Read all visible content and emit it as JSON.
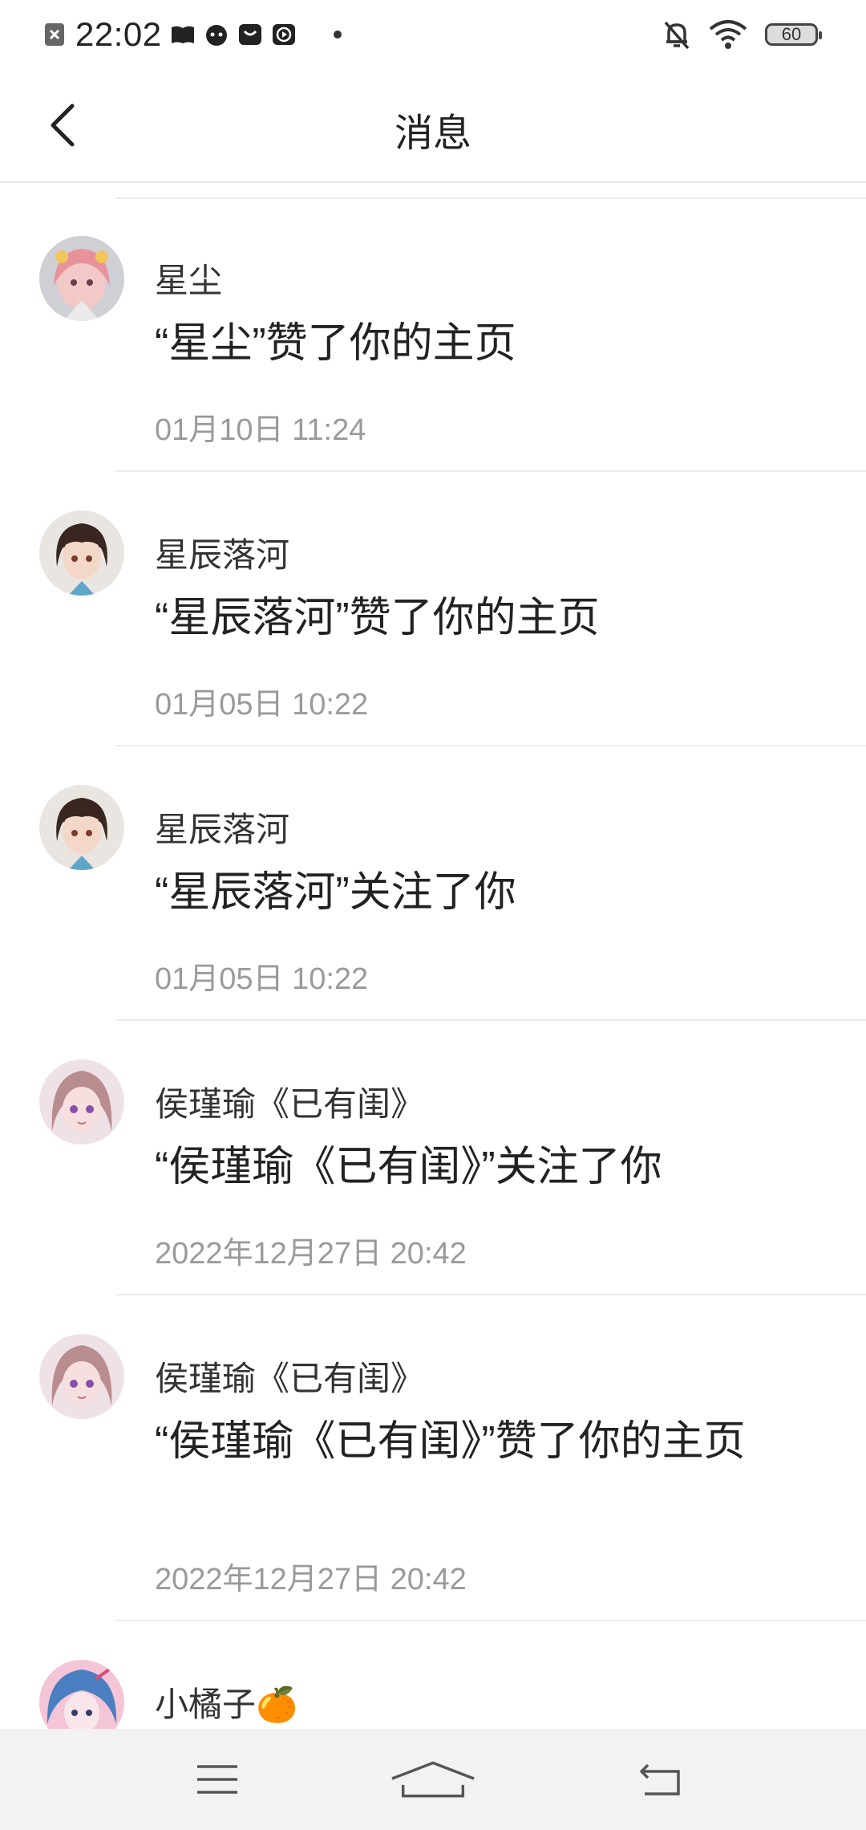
{
  "status": {
    "time": "22:02",
    "battery": "60"
  },
  "header": {
    "title": "消息"
  },
  "messages": [
    {
      "name": "星尘",
      "text": "“星尘”赞了你的主页",
      "time": "01月10日 11:24"
    },
    {
      "name": "星辰落河",
      "text": "“星辰落河”赞了你的主页",
      "time": "01月05日 10:22"
    },
    {
      "name": "星辰落河",
      "text": "“星辰落河”关注了你",
      "time": "01月05日 10:22"
    },
    {
      "name": "侯瑾瑜《已有闺》",
      "text": "“侯瑾瑜《已有闺》”关注了你",
      "time": "2022年12月27日 20:42"
    },
    {
      "name": "侯瑾瑜《已有闺》",
      "text": "“侯瑾瑜《已有闺》”赞了你的主页",
      "time": "2022年12月27日 20:42"
    },
    {
      "name": "小橘子🍊"
    }
  ],
  "icons": {
    "back": "chevron-left-icon",
    "menu": "menu-icon",
    "home": "home-icon",
    "return": "return-icon"
  },
  "colors": {
    "divider": "#ebebeb",
    "secondary_text": "#9a9a9a",
    "navbar_bg": "#f2f2f2"
  }
}
